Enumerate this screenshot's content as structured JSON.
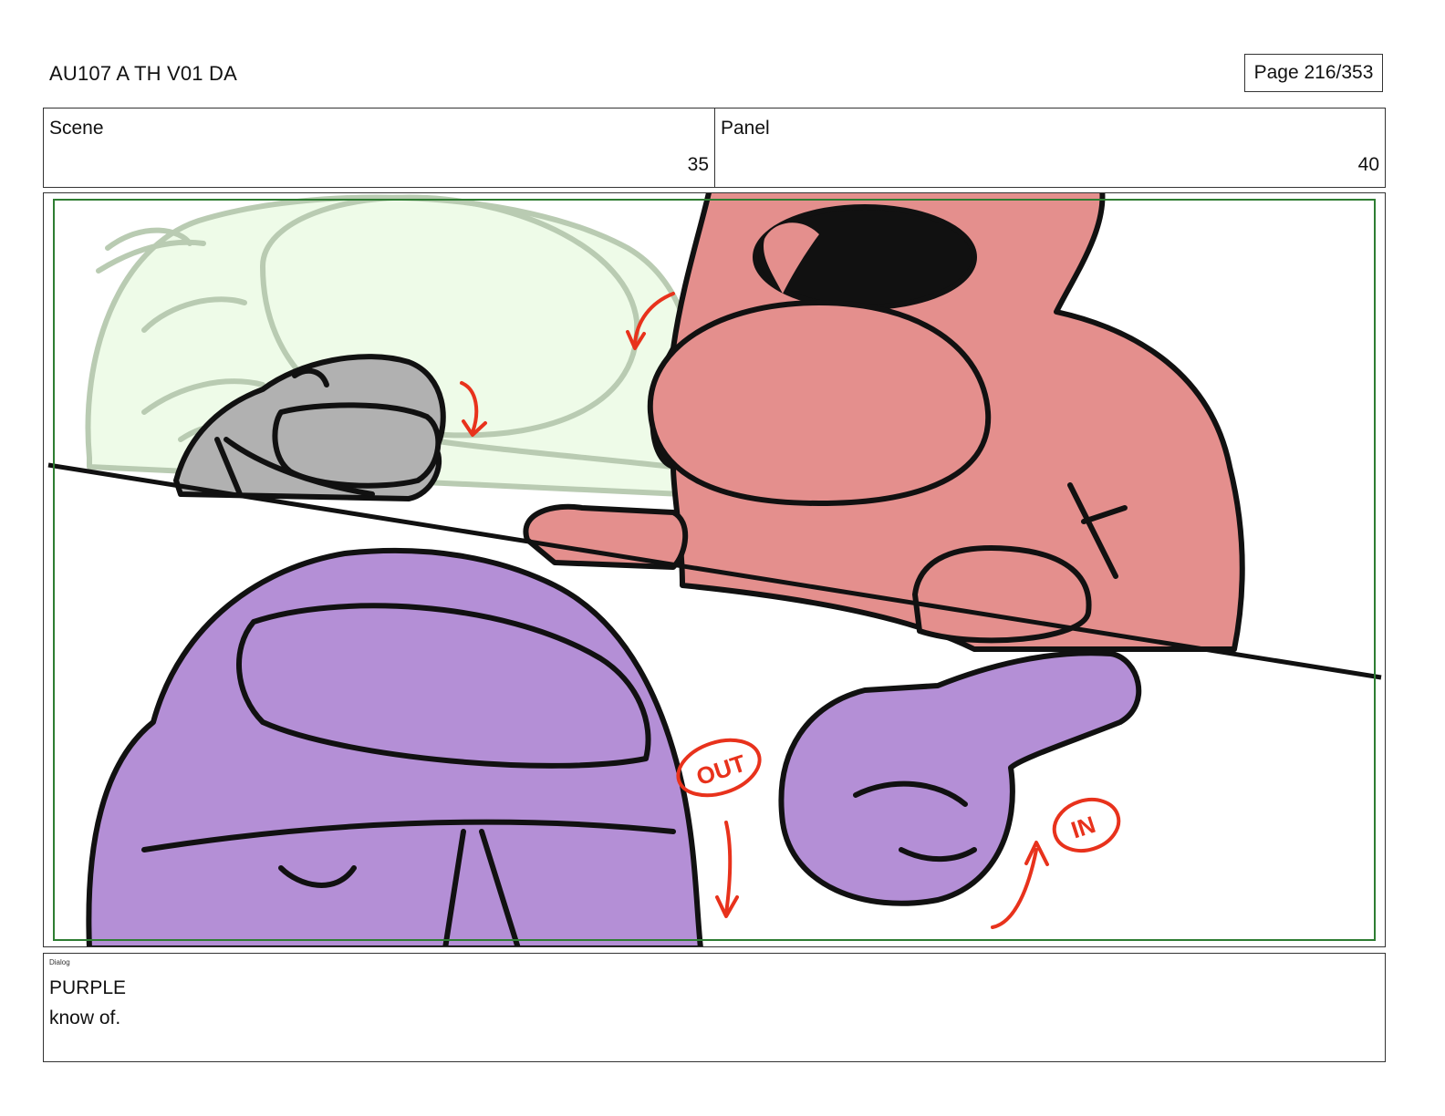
{
  "header": {
    "title": "AU107 A TH V01 DA",
    "page": "Page 216/353"
  },
  "info": {
    "scene_label": "Scene",
    "scene_value": "35",
    "panel_label": "Panel",
    "panel_value": "40"
  },
  "artwork": {
    "annotations": {
      "out": "OUT",
      "in": "IN"
    },
    "colors": {
      "safe_frame": "#2e7d32",
      "pink_character": "#e48f8d",
      "purple_character": "#b48fd6",
      "gray_character": "#b1b1b1",
      "ghost_character": "#eefbe8",
      "annotation_red": "#e8321c"
    }
  },
  "dialog": {
    "label": "Dialog",
    "speaker": "PURPLE",
    "line": "know of."
  }
}
